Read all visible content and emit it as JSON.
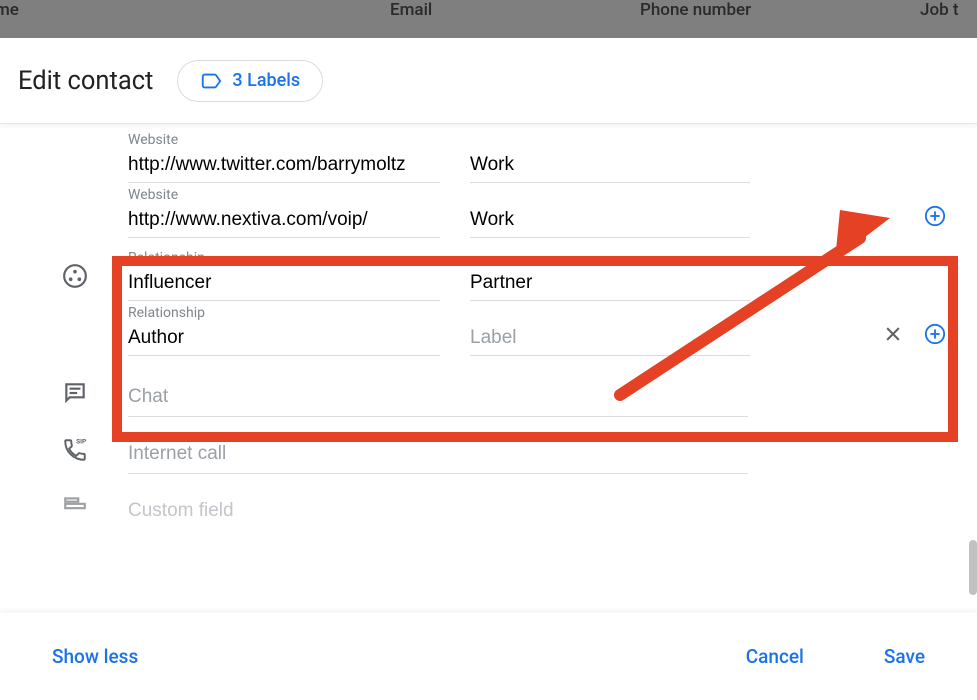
{
  "backgroundTable": {
    "col1": "me",
    "col2": "Email",
    "col3": "Phone number",
    "col4": "Job t"
  },
  "header": {
    "title": "Edit contact",
    "labelsChip": "3 Labels"
  },
  "websites": [
    {
      "label": "Website",
      "value": "http://www.twitter.com/barrymoltz",
      "type": "Work"
    },
    {
      "label": "Website",
      "value": "http://www.nextiva.com/voip/",
      "type": "Work"
    }
  ],
  "relationships": [
    {
      "label": "Relationship",
      "value": "Influencer",
      "type": "Partner",
      "typePlaceholder": ""
    },
    {
      "label": "Relationship",
      "value": "Author",
      "type": "",
      "typePlaceholder": "Label"
    }
  ],
  "sections": {
    "chat": "Chat",
    "internetCall": "Internet call",
    "customField": "Custom field"
  },
  "footer": {
    "showLess": "Show less",
    "cancel": "Cancel",
    "save": "Save"
  }
}
